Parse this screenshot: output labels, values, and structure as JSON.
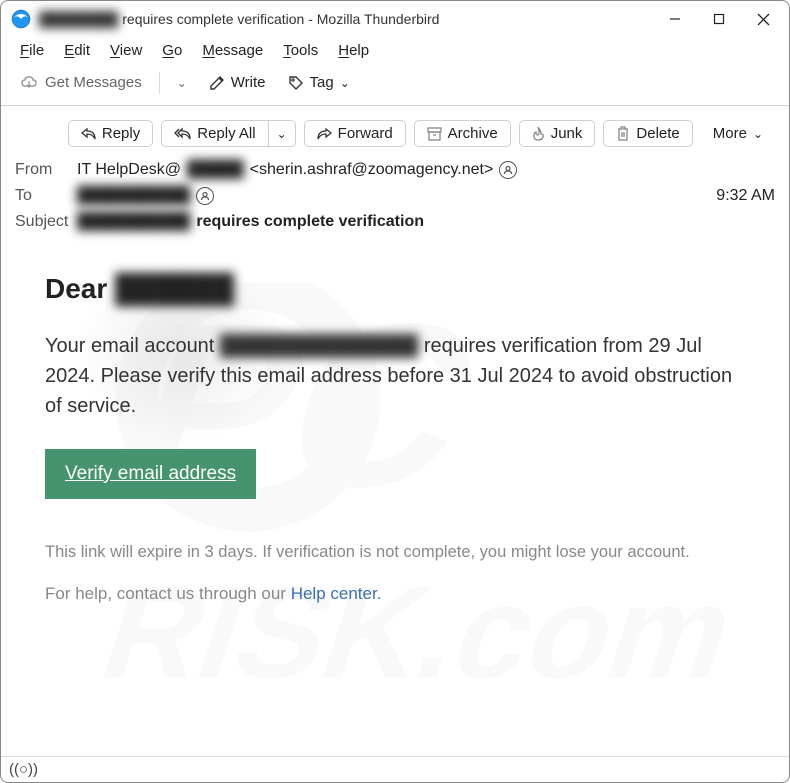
{
  "window": {
    "title_redacted": "████████",
    "title_rest": " requires complete verification - Mozilla Thunderbird"
  },
  "menu": {
    "file": "File",
    "edit": "Edit",
    "view": "View",
    "go": "Go",
    "message": "Message",
    "tools": "Tools",
    "help": "Help"
  },
  "toolbar": {
    "get_messages": "Get Messages",
    "write": "Write",
    "tag": "Tag"
  },
  "actions": {
    "reply": "Reply",
    "reply_all": "Reply All",
    "forward": "Forward",
    "archive": "Archive",
    "junk": "Junk",
    "delete": "Delete",
    "more": "More"
  },
  "headers": {
    "from_label": "From",
    "from_display": "IT HelpDesk@",
    "from_redacted": "█████",
    "from_email": "<sherin.ashraf@zoomagency.net>",
    "to_label": "To",
    "to_redacted": "██████████",
    "subject_label": "Subject",
    "subject_redacted": "██████████",
    "subject_text": "requires complete verification",
    "time": "9:32 AM"
  },
  "body": {
    "greeting": "Dear ",
    "greeting_redacted": "██████",
    "p1_a": "Your email account ",
    "p1_redacted": "██████████████",
    "p1_b": " requires verification from 29 Jul 2024. Please verify this email address before 31 Jul 2024  to avoid obstruction of service.",
    "cta": "Verify email address",
    "expire": "This link will expire in 3 days. If verification is not complete, you might lose your account.",
    "help_prefix": "For help, contact us through our  ",
    "help_link": "Help center."
  }
}
